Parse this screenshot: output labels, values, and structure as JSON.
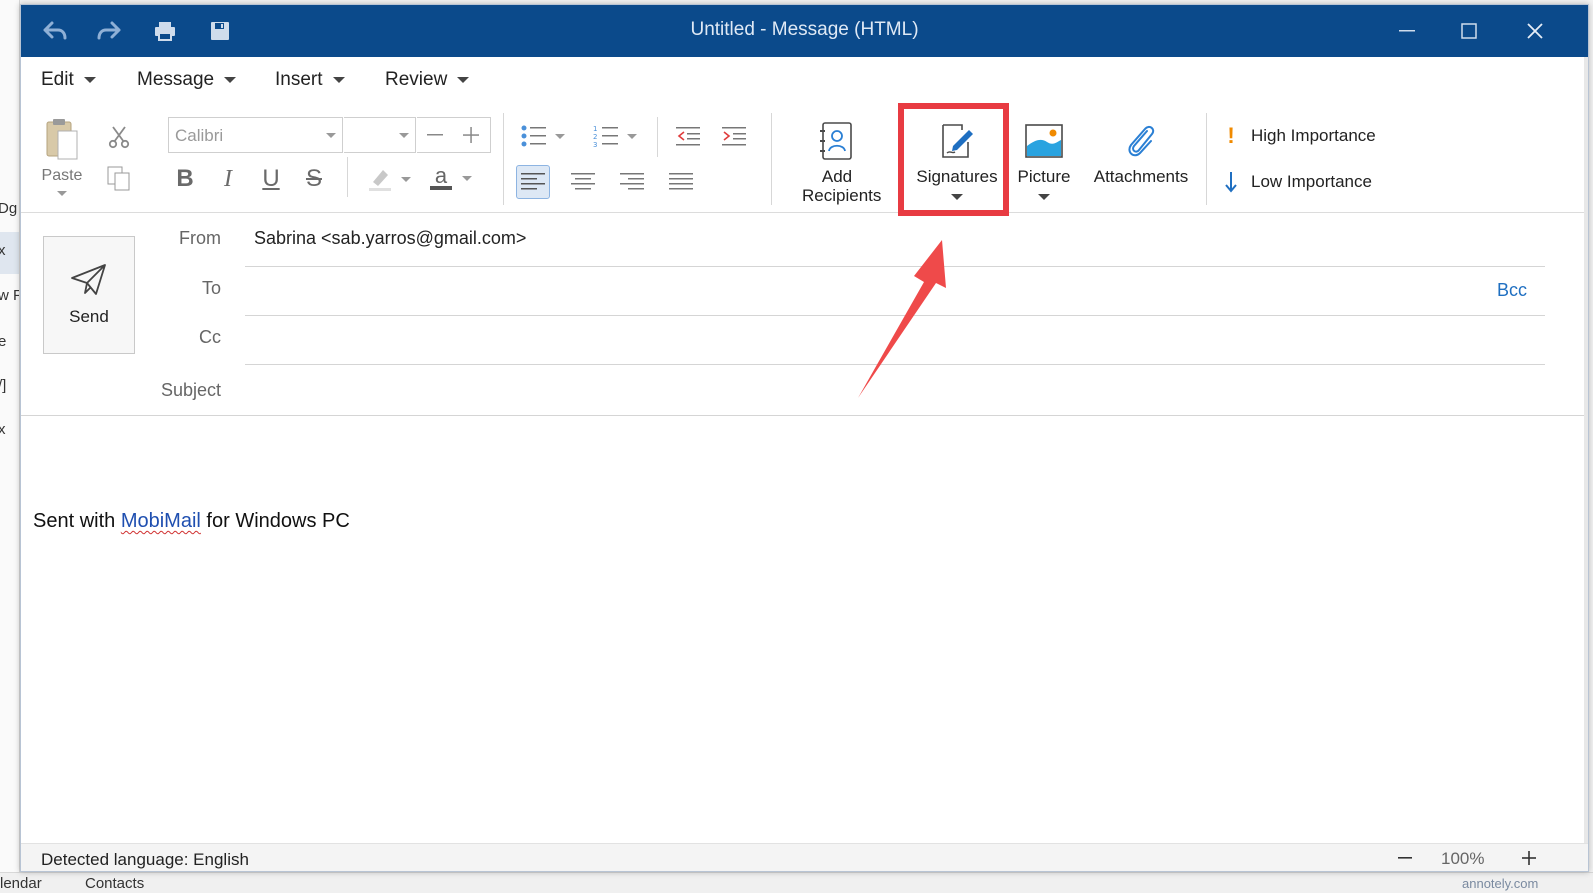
{
  "window": {
    "title": "Untitled - Message (HTML)"
  },
  "background": {
    "left_fragments": [
      "Dg",
      "x",
      "w F",
      "e",
      "/]",
      "x"
    ],
    "bottom_fragments": [
      "lendar",
      "Contacts",
      "annotely.com"
    ]
  },
  "menu": {
    "items": [
      "Edit",
      "Message",
      "Insert",
      "Review"
    ]
  },
  "ribbon": {
    "paste_label": "Paste",
    "font_placeholder": "Calibri",
    "bold": "B",
    "italic": "I",
    "underline": "U",
    "strike": "S",
    "font_color_letter": "a",
    "add_recipients_label": "Add Recipients",
    "signatures_label": "Signatures",
    "picture_label": "Picture",
    "attachments_label": "Attachments",
    "high_importance_label": "High Importance",
    "low_importance_label": "Low Importance",
    "colors": {
      "accent_blue": "#0b4a8b",
      "highlight_red": "#e83b42",
      "importance_orange": "#f08a00"
    }
  },
  "compose": {
    "send_label": "Send",
    "from_label": "From",
    "from_value": "Sabrina <sab.yarros@gmail.com>",
    "to_label": "To",
    "cc_label": "Cc",
    "subject_label": "Subject",
    "bcc_label": "Bcc",
    "body_prefix": "Sent with ",
    "body_link": "MobiMail",
    "body_suffix": " for Windows PC"
  },
  "status": {
    "language": "Detected language: English",
    "zoom": "100%"
  }
}
